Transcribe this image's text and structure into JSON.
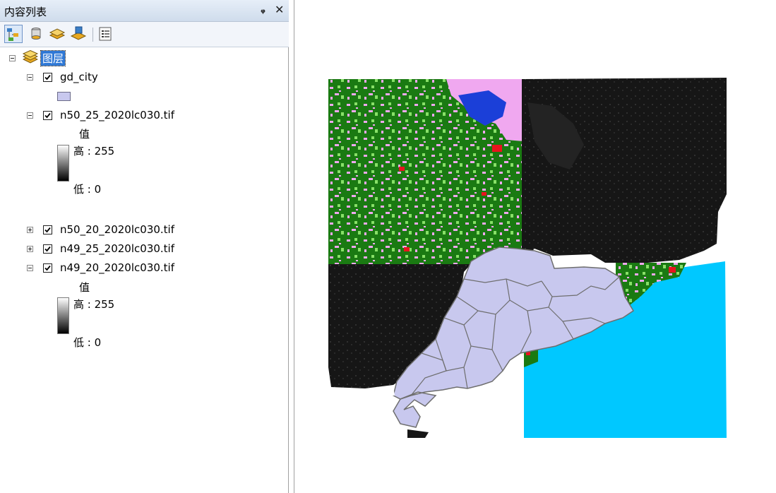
{
  "toc": {
    "title": "内容列表",
    "pin_icon": "pin-icon",
    "close_icon": "close-icon",
    "toolbar": {
      "buttons": [
        {
          "name": "list-by-drawing-order",
          "icon": "drawing-order-icon"
        },
        {
          "name": "list-by-source",
          "icon": "source-icon"
        },
        {
          "name": "list-by-visibility",
          "icon": "visibility-icon"
        },
        {
          "name": "list-by-selection",
          "icon": "selection-icon"
        },
        {
          "name": "options",
          "icon": "options-icon"
        }
      ]
    },
    "root": {
      "label": "图层",
      "icon": "layers-icon"
    },
    "layers": [
      {
        "name": "gd_city",
        "checked": true,
        "expanded": true,
        "symbol_color": "#c8c8ee"
      },
      {
        "name": "n50_25_2020lc030.tif",
        "checked": true,
        "expanded": true,
        "legend": {
          "heading": "值",
          "high": "高 : 255",
          "low": "低 : 0"
        }
      },
      {
        "name": "n50_20_2020lc030.tif",
        "checked": true,
        "expanded": false
      },
      {
        "name": "n49_25_2020lc030.tif",
        "checked": true,
        "expanded": false
      },
      {
        "name": "n49_20_2020lc030.tif",
        "checked": true,
        "expanded": true,
        "legend": {
          "heading": "值",
          "high": "高 : 255",
          "low": "低 : 0"
        }
      }
    ]
  },
  "map": {
    "colors": {
      "forest": "#1a7a12",
      "cropland": "#f0a8f0",
      "grass": "#88e068",
      "water": "#1b3fd8",
      "urban": "#e8141e",
      "dark_raster": "#161616",
      "sea": "#00c8ff",
      "province": "#c8c8ee",
      "boundary": "#6e6e6e"
    }
  }
}
